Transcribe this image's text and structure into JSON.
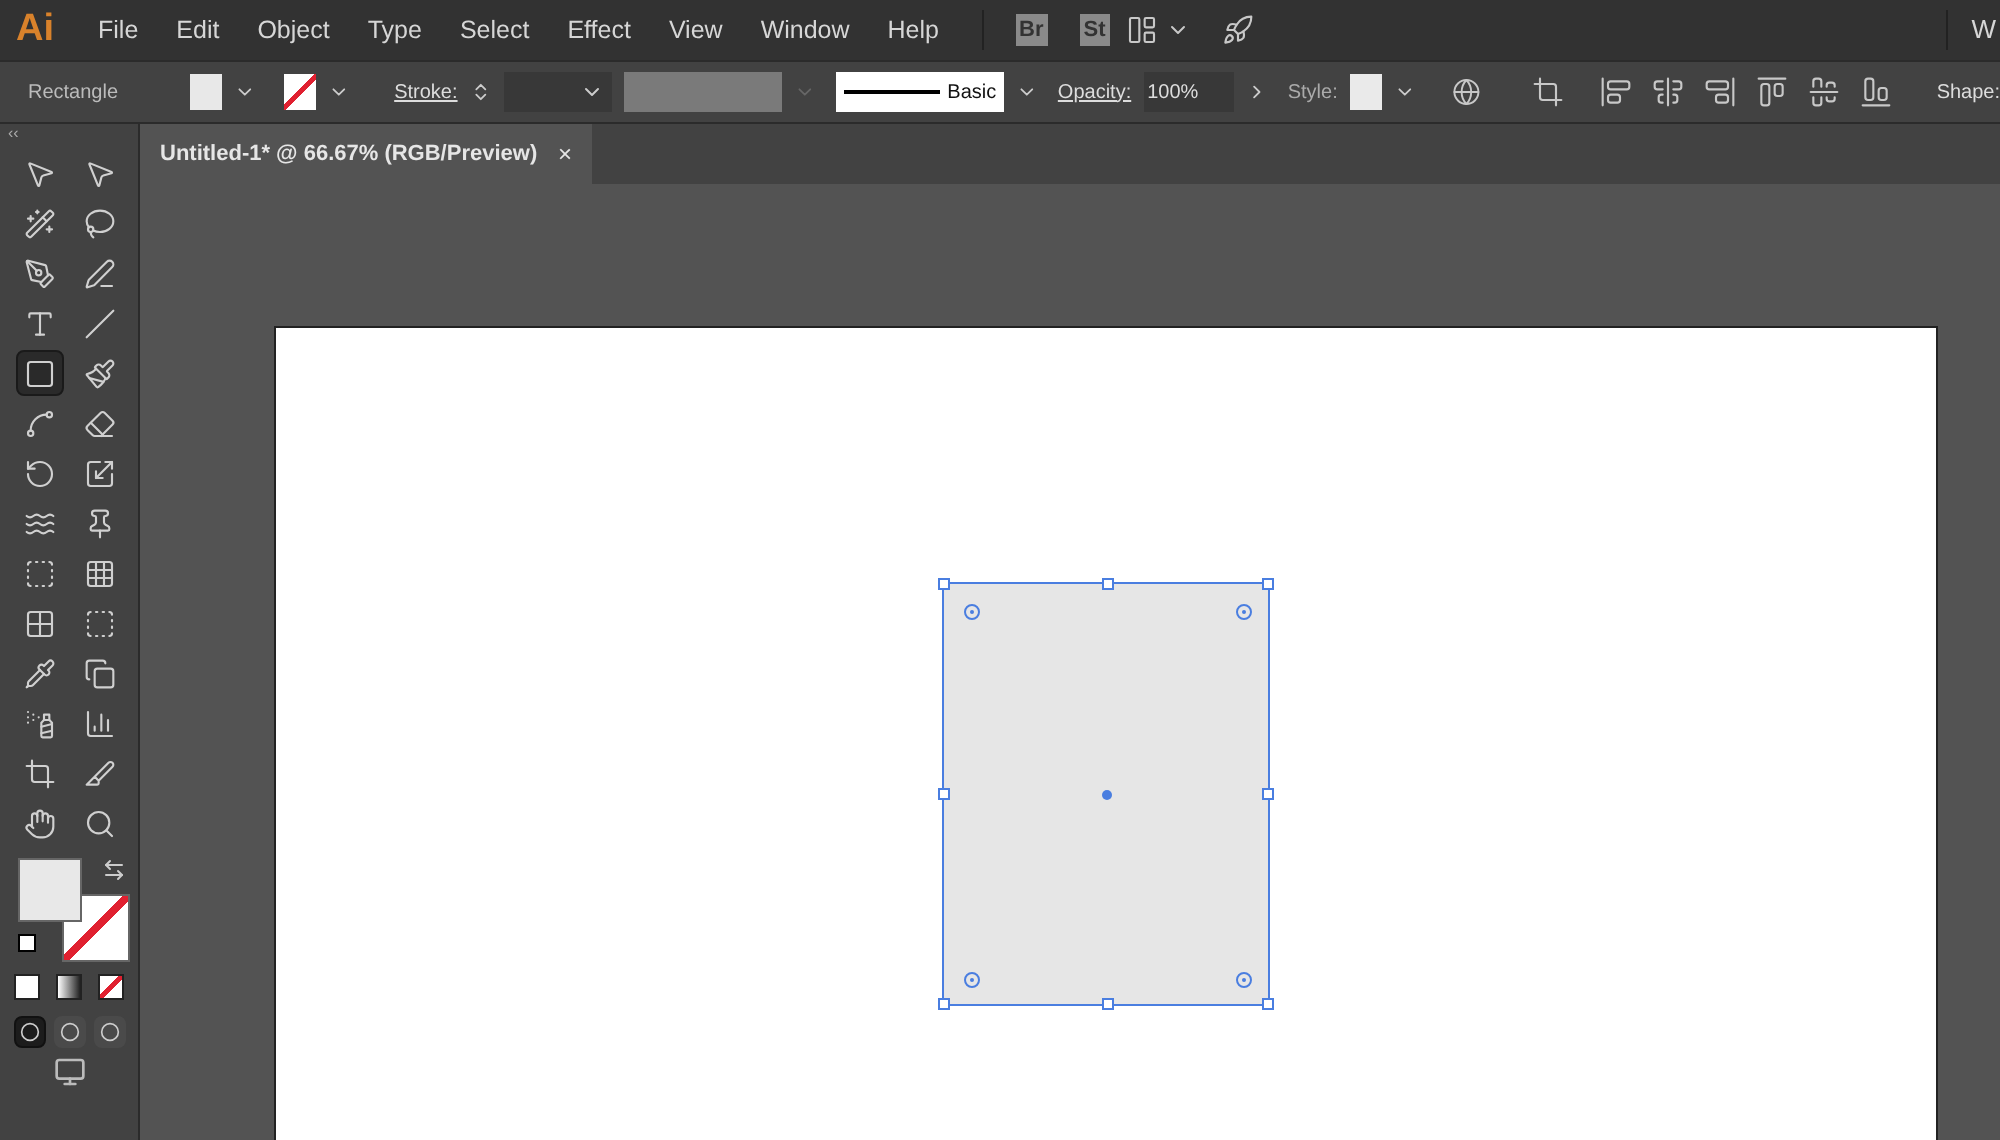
{
  "menu_bar": {
    "app_logo": "Ai",
    "items": [
      "File",
      "Edit",
      "Object",
      "Type",
      "Select",
      "Effect",
      "View",
      "Window",
      "Help"
    ],
    "bridge_buttons": [
      "Br",
      "St"
    ],
    "workspace_label": "W"
  },
  "control_bar": {
    "tool_name": "Rectangle",
    "stroke_label": "Stroke:",
    "brush_name": "Basic",
    "opacity_label": "Opacity:",
    "opacity_value": "100%",
    "style_label": "Style:",
    "shape_label": "Shape:"
  },
  "document_tab": {
    "title": "Untitled-1* @ 66.67% (RGB/Preview)",
    "close": "×"
  },
  "toolbar": {
    "collapse": "‹‹",
    "tools": [
      {
        "selected": false
      },
      {
        "selected": false
      },
      {
        "selected": false
      },
      {
        "selected": false
      },
      {
        "selected": false
      },
      {
        "selected": false
      },
      {
        "selected": false
      },
      {
        "selected": false
      },
      {
        "selected": true
      },
      {
        "selected": false
      },
      {
        "selected": false
      },
      {
        "selected": false
      },
      {
        "selected": false
      },
      {
        "selected": false
      },
      {
        "selected": false
      },
      {
        "selected": false
      },
      {
        "selected": false
      },
      {
        "selected": false
      },
      {
        "selected": false
      },
      {
        "selected": false
      },
      {
        "selected": false
      },
      {
        "selected": false
      },
      {
        "selected": false
      },
      {
        "selected": false
      },
      {
        "selected": false
      },
      {
        "selected": false
      },
      {
        "selected": false
      },
      {
        "selected": false
      }
    ],
    "draw_modes": [
      {
        "selected": true
      },
      {
        "selected": false
      },
      {
        "selected": false
      }
    ]
  },
  "canvas": {
    "rectangle": {
      "selected": true
    }
  }
}
